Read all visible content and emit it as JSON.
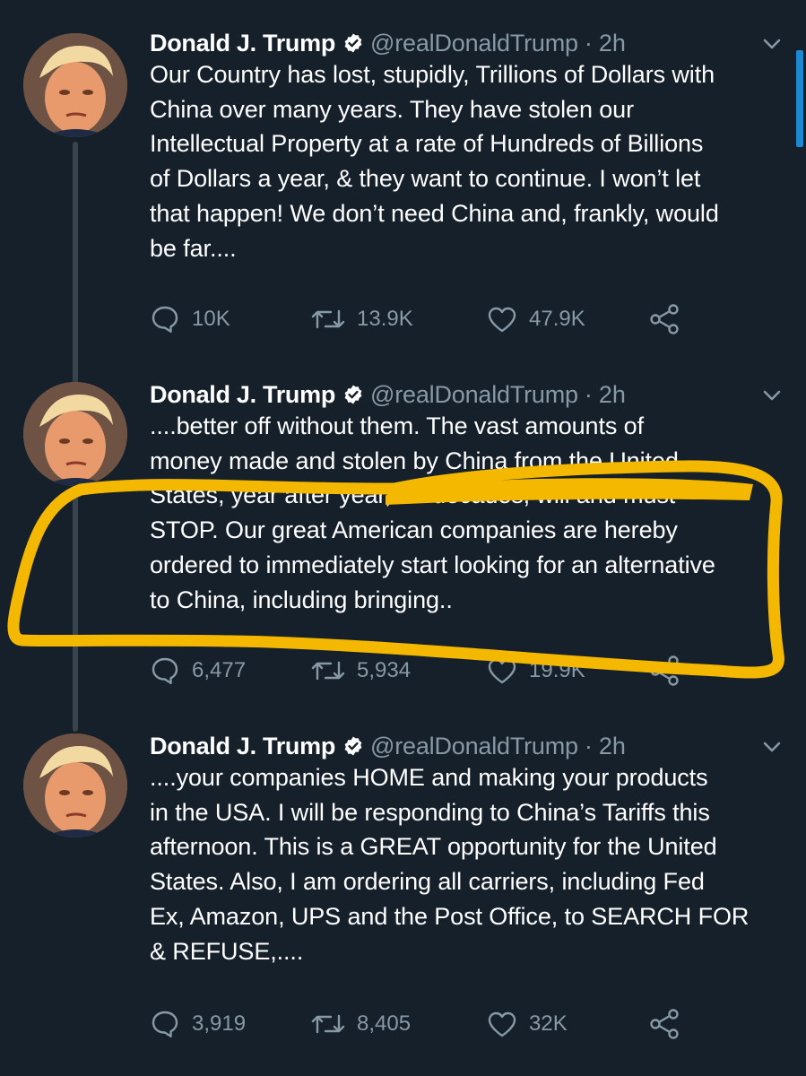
{
  "colors": {
    "background": "#15202b",
    "secondary_text": "#8899a6",
    "thread_line": "#38444d",
    "highlight": "#f5b800"
  },
  "tweets": [
    {
      "name": "Donald J. Trump",
      "handle": "@realDonaldTrump",
      "separator": "·",
      "time": "2h",
      "lines": [
        "Our Country has lost, stupidly, Trillions of Dollars with",
        "China over many years. They have stolen our",
        "Intellectual Property at a rate of Hundreds of Billions",
        "of Dollars a year, & they want to continue. I won’t let",
        "that happen! We don’t need China and, frankly, would",
        "be far...."
      ],
      "replies": "10K",
      "retweets": "13.9K",
      "likes": "47.9K"
    },
    {
      "name": "Donald J. Trump",
      "handle": "@realDonaldTrump",
      "separator": "·",
      "time": "2h",
      "lines": [
        "....better off without them. The vast amounts of",
        "money made and stolen by China from the United",
        "States, year after year, for decades, will and must",
        "STOP. Our great American companies are hereby",
        "ordered to immediately start looking for an alternative",
        "to China, including bringing.."
      ],
      "replies": "6,477",
      "retweets": "5,934",
      "likes": "19.9K"
    },
    {
      "name": "Donald J. Trump",
      "handle": "@realDonaldTrump",
      "separator": "·",
      "time": "2h",
      "lines": [
        "....your companies HOME and making your products",
        "in the USA. I will be responding to China’s Tariffs this",
        "afternoon. This is a GREAT opportunity for the United",
        "States. Also, I am ordering all carriers, including Fed",
        "Ex, Amazon, UPS and the Post Office, to SEARCH FOR",
        "& REFUSE,...."
      ],
      "replies": "3,919",
      "retweets": "8,405",
      "likes": "32K"
    }
  ]
}
